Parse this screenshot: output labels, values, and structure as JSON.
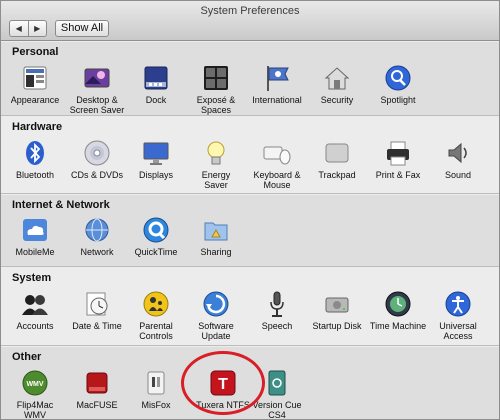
{
  "window": {
    "title": "System Preferences",
    "show_all": "Show All",
    "back_glyph": "◀",
    "forward_glyph": "▶"
  },
  "sections": {
    "personal": {
      "title": "Personal",
      "items": [
        {
          "label": "Appearance",
          "icon": "appearance-icon"
        },
        {
          "label": "Desktop &\nScreen Saver",
          "icon": "desktop-screen-saver-icon"
        },
        {
          "label": "Dock",
          "icon": "dock-icon"
        },
        {
          "label": "Exposé &\nSpaces",
          "icon": "expose-spaces-icon"
        },
        {
          "label": "International",
          "icon": "international-flag-icon"
        },
        {
          "label": "Security",
          "icon": "security-house-icon"
        },
        {
          "label": "Spotlight",
          "icon": "spotlight-magnifier-icon"
        }
      ]
    },
    "hardware": {
      "title": "Hardware",
      "items": [
        {
          "label": "Bluetooth",
          "icon": "bluetooth-icon"
        },
        {
          "label": "CDs & DVDs",
          "icon": "cd-dvd-icon"
        },
        {
          "label": "Displays",
          "icon": "display-monitor-icon"
        },
        {
          "label": "Energy\nSaver",
          "icon": "light-bulb-icon"
        },
        {
          "label": "Keyboard &\nMouse",
          "icon": "keyboard-mouse-icon"
        },
        {
          "label": "Trackpad",
          "icon": "trackpad-icon"
        },
        {
          "label": "Print & Fax",
          "icon": "printer-icon"
        },
        {
          "label": "Sound",
          "icon": "speaker-icon"
        }
      ]
    },
    "internet": {
      "title": "Internet & Network",
      "items": [
        {
          "label": "MobileMe",
          "icon": "mobileme-cloud-icon"
        },
        {
          "label": "Network",
          "icon": "network-globe-icon"
        },
        {
          "label": "QuickTime",
          "icon": "quicktime-icon"
        },
        {
          "label": "Sharing",
          "icon": "sharing-folder-icon"
        }
      ]
    },
    "system": {
      "title": "System",
      "items": [
        {
          "label": "Accounts",
          "icon": "accounts-silhouette-icon"
        },
        {
          "label": "Date & Time",
          "icon": "date-time-clock-icon"
        },
        {
          "label": "Parental\nControls",
          "icon": "parental-controls-icon"
        },
        {
          "label": "Software\nUpdate",
          "icon": "software-update-icon"
        },
        {
          "label": "Speech",
          "icon": "speech-microphone-icon"
        },
        {
          "label": "Startup Disk",
          "icon": "startup-disk-icon"
        },
        {
          "label": "Time Machine",
          "icon": "time-machine-icon"
        },
        {
          "label": "Universal\nAccess",
          "icon": "universal-access-icon"
        }
      ]
    },
    "other": {
      "title": "Other",
      "items": [
        {
          "label": "Flip4Mac\nWMV",
          "icon": "flip4mac-wmv-icon",
          "badge": "WMV"
        },
        {
          "label": "MacFUSE",
          "icon": "macfuse-drive-icon"
        },
        {
          "label": "MisFox",
          "icon": "misfox-switch-icon"
        },
        {
          "label": "Tuxera NTFS",
          "icon": "tuxera-ntfs-icon",
          "badge": "T"
        },
        {
          "label": "Version Cue\nCS4",
          "icon": "version-cue-icon"
        }
      ]
    }
  },
  "colors": {
    "highlight_circle": "#d81e26",
    "tuxera_red": "#c4141d",
    "spotlight_blue": "#2f67d8"
  }
}
